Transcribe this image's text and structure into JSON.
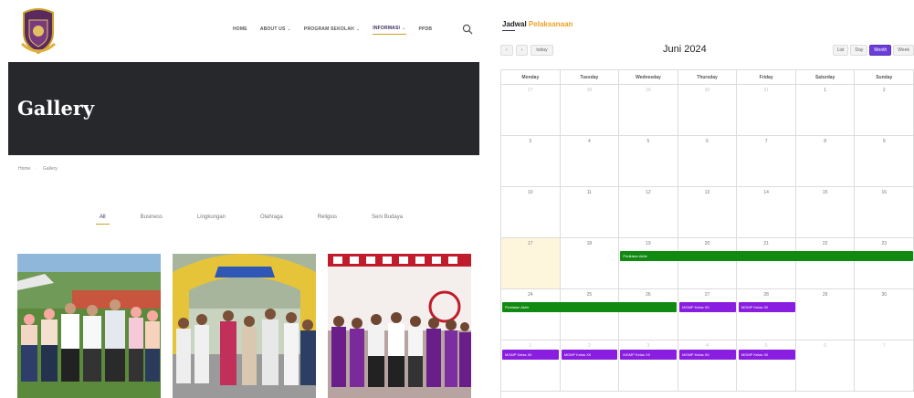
{
  "site": {
    "nav": [
      {
        "label": "Home",
        "caret": false,
        "active": false
      },
      {
        "label": "About Us",
        "caret": true,
        "active": false
      },
      {
        "label": "Program Sekolah",
        "caret": true,
        "active": false
      },
      {
        "label": "Informasi",
        "caret": true,
        "active": true
      },
      {
        "label": "PPDB",
        "caret": false,
        "active": false
      }
    ],
    "hero_title": "Gallery",
    "breadcrumb": [
      "Home",
      "Gallery"
    ],
    "filters": [
      {
        "label": "All",
        "active": true
      },
      {
        "label": "Business",
        "active": false
      },
      {
        "label": "Lingkungan",
        "active": false
      },
      {
        "label": "Olahraga",
        "active": false
      },
      {
        "label": "Religius",
        "active": false
      },
      {
        "label": "Seni Budaya",
        "active": false
      }
    ]
  },
  "calendar": {
    "heading_main": "Jadwal",
    "heading_accent": "Pelaksanaan",
    "title": "Juni 2024",
    "nav_prev": "‹",
    "nav_next": "›",
    "today_label": "today",
    "views": [
      {
        "label": "List",
        "active": false
      },
      {
        "label": "Day",
        "active": false
      },
      {
        "label": "Month",
        "active": true
      },
      {
        "label": "Week",
        "active": false
      }
    ],
    "weekdays": [
      "Monday",
      "Tuesday",
      "Wednesday",
      "Thursday",
      "Friday",
      "Saturday",
      "Sunday"
    ],
    "weeks": [
      [
        "27",
        "28",
        "29",
        "30",
        "31",
        "1",
        "2"
      ],
      [
        "3",
        "4",
        "5",
        "6",
        "7",
        "8",
        "9"
      ],
      [
        "10",
        "11",
        "12",
        "13",
        "14",
        "15",
        "16"
      ],
      [
        "17",
        "18",
        "19",
        "20",
        "21",
        "22",
        "23"
      ],
      [
        "24",
        "25",
        "26",
        "27",
        "28",
        "29",
        "30"
      ],
      [
        "1",
        "2",
        "3",
        "4",
        "5",
        "6",
        "7"
      ]
    ],
    "events": [
      {
        "label": "Penilaian Akhir",
        "week": 3,
        "start": 2,
        "span": 5,
        "color": "#118a11"
      },
      {
        "label": "Penilaian Akhir",
        "week": 4,
        "start": 0,
        "span": 3,
        "color": "#118a11"
      },
      {
        "label": "MGMP Kelas XII",
        "week": 4,
        "start": 3,
        "span": 1,
        "color": "#8a1ee0"
      },
      {
        "label": "MGMP Kelas XII",
        "week": 4,
        "start": 4,
        "span": 1,
        "color": "#8a1ee0"
      },
      {
        "label": "MGMP Kelas XII",
        "week": 5,
        "start": 0,
        "span": 1,
        "color": "#8a1ee0"
      },
      {
        "label": "MGMP Kelas XII",
        "week": 5,
        "start": 1,
        "span": 1,
        "color": "#8a1ee0"
      },
      {
        "label": "MGMP Kelas XII",
        "week": 5,
        "start": 2,
        "span": 1,
        "color": "#8a1ee0"
      },
      {
        "label": "MGMP Kelas XII",
        "week": 5,
        "start": 3,
        "span": 1,
        "color": "#8a1ee0"
      },
      {
        "label": "MGMP Kelas XII",
        "week": 5,
        "start": 4,
        "span": 1,
        "color": "#8a1ee0"
      }
    ],
    "colors": {
      "accent": "#f0a020",
      "brand": "#3b2b5c",
      "active_view": "#6b3fd6"
    }
  },
  "icons": {
    "search": "search-icon",
    "logo": "school-crest-logo"
  }
}
